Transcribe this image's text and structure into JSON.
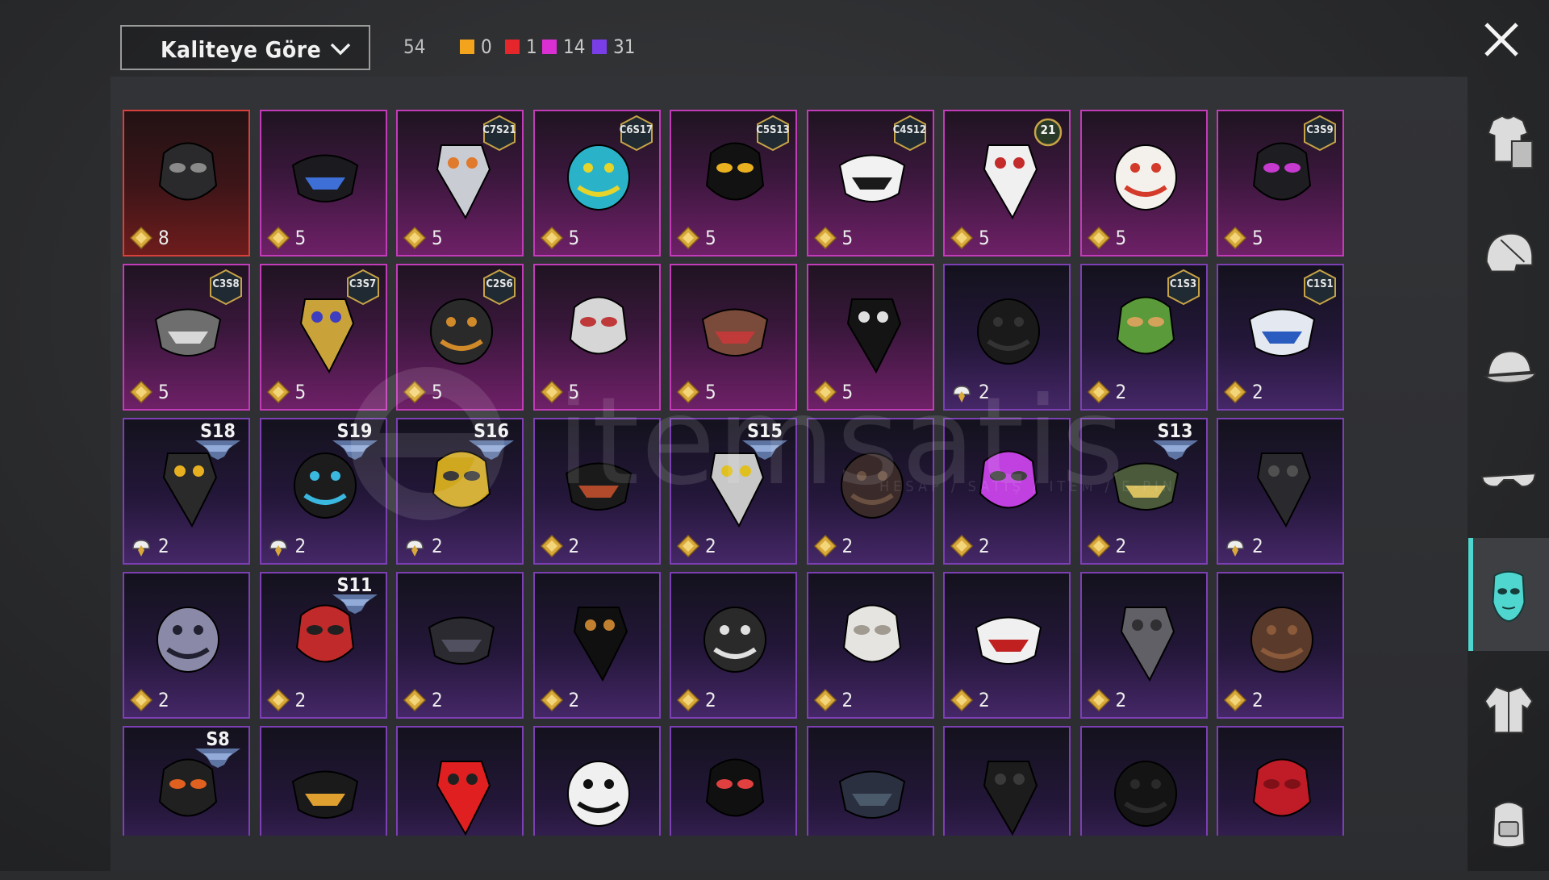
{
  "header": {
    "sort_label": "Kaliteye Göre",
    "total_count": "54",
    "quality_counts": [
      {
        "color": "#f4a31c",
        "count": "0"
      },
      {
        "color": "#e5262b",
        "count": "1"
      },
      {
        "color": "#d92fd3",
        "count": "14"
      },
      {
        "color": "#7a3ee8",
        "count": "31"
      }
    ]
  },
  "items": [
    {
      "quality": "red",
      "currency": "bp",
      "price": "8",
      "badge": "",
      "badge_type": "none"
    },
    {
      "quality": "pink",
      "currency": "bp",
      "price": "5",
      "badge": "",
      "badge_type": "none"
    },
    {
      "quality": "pink",
      "currency": "bp",
      "price": "5",
      "badge": "C7S21",
      "badge_type": "hex"
    },
    {
      "quality": "pink",
      "currency": "bp",
      "price": "5",
      "badge": "C6S17",
      "badge_type": "hex"
    },
    {
      "quality": "pink",
      "currency": "bp",
      "price": "5",
      "badge": "C5S13",
      "badge_type": "hex"
    },
    {
      "quality": "pink",
      "currency": "bp",
      "price": "5",
      "badge": "C4S12",
      "badge_type": "hex"
    },
    {
      "quality": "pink",
      "currency": "bp",
      "price": "5",
      "badge": "21",
      "badge_type": "level"
    },
    {
      "quality": "pink",
      "currency": "bp",
      "price": "5",
      "badge": "",
      "badge_type": "none"
    },
    {
      "quality": "pink",
      "currency": "bp",
      "price": "5",
      "badge": "C3S9",
      "badge_type": "hex"
    },
    {
      "quality": "pink",
      "currency": "bp",
      "price": "5",
      "badge": "C3S8",
      "badge_type": "hex"
    },
    {
      "quality": "pink",
      "currency": "bp",
      "price": "5",
      "badge": "C3S7",
      "badge_type": "hex"
    },
    {
      "quality": "pink",
      "currency": "bp",
      "price": "5",
      "badge": "C2S6",
      "badge_type": "hex"
    },
    {
      "quality": "pink",
      "currency": "bp",
      "price": "5",
      "badge": "",
      "badge_type": "none"
    },
    {
      "quality": "pink",
      "currency": "bp",
      "price": "5",
      "badge": "",
      "badge_type": "none"
    },
    {
      "quality": "pink",
      "currency": "bp",
      "price": "5",
      "badge": "",
      "badge_type": "none"
    },
    {
      "quality": "purple",
      "currency": "ag",
      "price": "2",
      "badge": "",
      "badge_type": "none"
    },
    {
      "quality": "purple",
      "currency": "bp",
      "price": "2",
      "badge": "C1S3",
      "badge_type": "hex"
    },
    {
      "quality": "purple",
      "currency": "bp",
      "price": "2",
      "badge": "C1S1",
      "badge_type": "hex"
    },
    {
      "quality": "purple",
      "currency": "ag",
      "price": "2",
      "badge": "S18",
      "badge_type": "season"
    },
    {
      "quality": "purple",
      "currency": "ag",
      "price": "2",
      "badge": "S19",
      "badge_type": "season"
    },
    {
      "quality": "purple",
      "currency": "ag",
      "price": "2",
      "badge": "S16",
      "badge_type": "season"
    },
    {
      "quality": "purple",
      "currency": "bp",
      "price": "2",
      "badge": "",
      "badge_type": "none"
    },
    {
      "quality": "purple",
      "currency": "bp",
      "price": "2",
      "badge": "S15",
      "badge_type": "season"
    },
    {
      "quality": "purple",
      "currency": "bp",
      "price": "2",
      "badge": "",
      "badge_type": "none"
    },
    {
      "quality": "purple",
      "currency": "bp",
      "price": "2",
      "badge": "",
      "badge_type": "none"
    },
    {
      "quality": "purple",
      "currency": "bp",
      "price": "2",
      "badge": "S13",
      "badge_type": "season"
    },
    {
      "quality": "purple",
      "currency": "ag",
      "price": "2",
      "badge": "",
      "badge_type": "none"
    },
    {
      "quality": "purple",
      "currency": "bp",
      "price": "2",
      "badge": "",
      "badge_type": "none"
    },
    {
      "quality": "purple",
      "currency": "bp",
      "price": "2",
      "badge": "S11",
      "badge_type": "season"
    },
    {
      "quality": "purple",
      "currency": "bp",
      "price": "2",
      "badge": "",
      "badge_type": "none"
    },
    {
      "quality": "purple",
      "currency": "bp",
      "price": "2",
      "badge": "",
      "badge_type": "none"
    },
    {
      "quality": "purple",
      "currency": "bp",
      "price": "2",
      "badge": "",
      "badge_type": "none"
    },
    {
      "quality": "purple",
      "currency": "bp",
      "price": "2",
      "badge": "",
      "badge_type": "none"
    },
    {
      "quality": "purple",
      "currency": "bp",
      "price": "2",
      "badge": "",
      "badge_type": "none"
    },
    {
      "quality": "purple",
      "currency": "bp",
      "price": "2",
      "badge": "",
      "badge_type": "none"
    },
    {
      "quality": "purple",
      "currency": "bp",
      "price": "2",
      "badge": "",
      "badge_type": "none"
    },
    {
      "quality": "purple",
      "currency": "none",
      "price": "",
      "badge": "S8",
      "badge_type": "season"
    },
    {
      "quality": "purple",
      "currency": "none",
      "price": "",
      "badge": "",
      "badge_type": "none"
    },
    {
      "quality": "purple",
      "currency": "none",
      "price": "",
      "badge": "",
      "badge_type": "none"
    },
    {
      "quality": "purple",
      "currency": "none",
      "price": "",
      "badge": "",
      "badge_type": "none"
    },
    {
      "quality": "purple",
      "currency": "none",
      "price": "",
      "badge": "",
      "badge_type": "none"
    },
    {
      "quality": "purple",
      "currency": "none",
      "price": "",
      "badge": "",
      "badge_type": "none"
    },
    {
      "quality": "purple",
      "currency": "none",
      "price": "",
      "badge": "",
      "badge_type": "none"
    },
    {
      "quality": "purple",
      "currency": "none",
      "price": "",
      "badge": "",
      "badge_type": "none"
    },
    {
      "quality": "purple",
      "currency": "none",
      "price": "",
      "badge": "",
      "badge_type": "none"
    }
  ],
  "sidebar": [
    {
      "icon": "outfit-icon",
      "active": false
    },
    {
      "icon": "helmet-icon",
      "active": false
    },
    {
      "icon": "cap-icon",
      "active": false
    },
    {
      "icon": "glasses-icon",
      "active": false
    },
    {
      "icon": "mask-icon",
      "active": true
    },
    {
      "icon": "jacket-icon",
      "active": false
    },
    {
      "icon": "backpack-icon",
      "active": false
    }
  ],
  "watermark": {
    "brand": "itemsatis",
    "tagline": "HESAP / SATIŞ / ITEM / E-PIN"
  }
}
